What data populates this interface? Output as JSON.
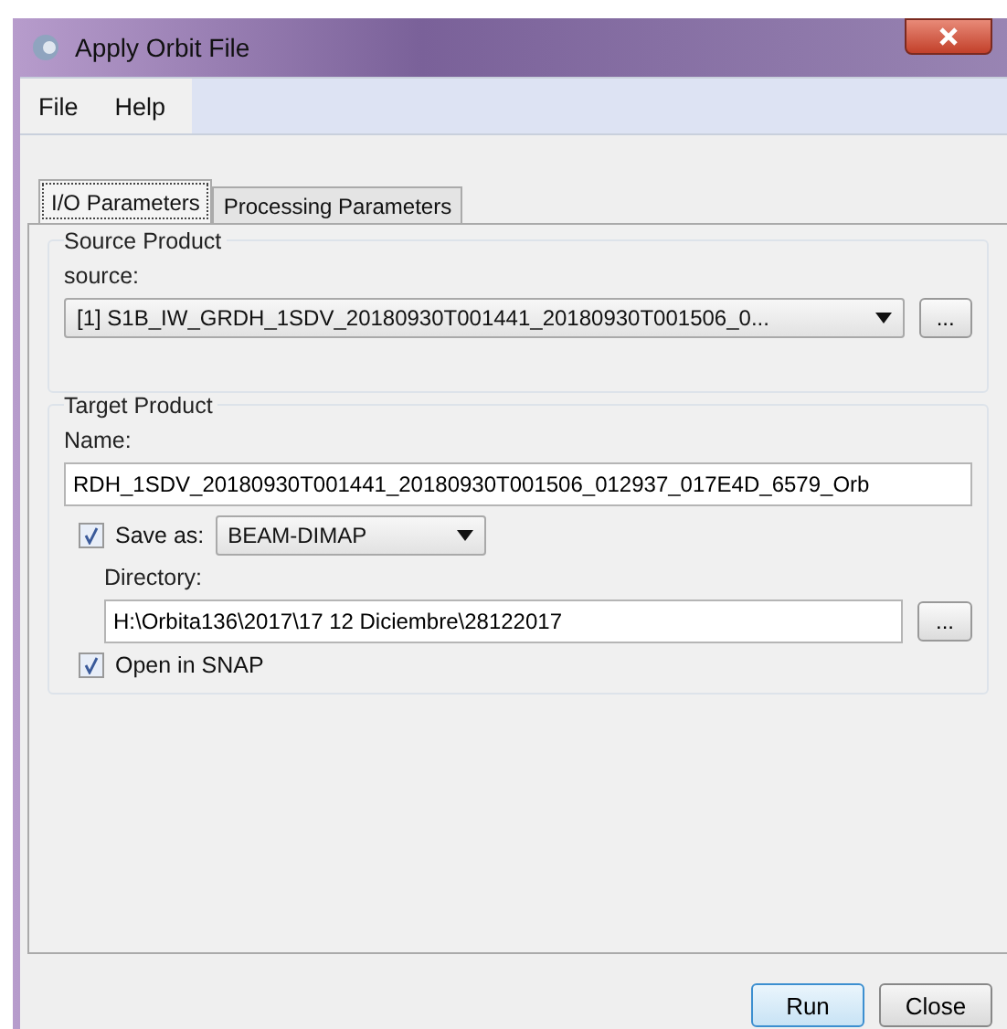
{
  "window": {
    "title": "Apply Orbit File"
  },
  "menu": [
    "File",
    "Help"
  ],
  "tabs": [
    {
      "label": "I/O Parameters",
      "selected": true
    },
    {
      "label": "Processing Parameters",
      "selected": false
    }
  ],
  "source_product": {
    "heading": "Source Product",
    "label": "source:",
    "value": "[1] S1B_IW_GRDH_1SDV_20180930T001441_20180930T001506_0...",
    "browse": "..."
  },
  "target_product": {
    "heading": "Target Product",
    "name_label": "Name:",
    "name": "RDH_1SDV_20180930T001441_20180930T001506_012937_017E4D_6579_Orb",
    "save_as": {
      "label": "Save as:",
      "checked": true,
      "format": "BEAM-DIMAP"
    },
    "directory_label": "Directory:",
    "directory": "H:\\Orbita136\\2017\\17 12 Diciembre\\28122017",
    "browse": "...",
    "open_in_snap": {
      "label": "Open in SNAP",
      "checked": true
    }
  },
  "buttons": [
    {
      "label": "Run",
      "selected": true
    },
    {
      "label": "Close",
      "selected": false
    }
  ]
}
